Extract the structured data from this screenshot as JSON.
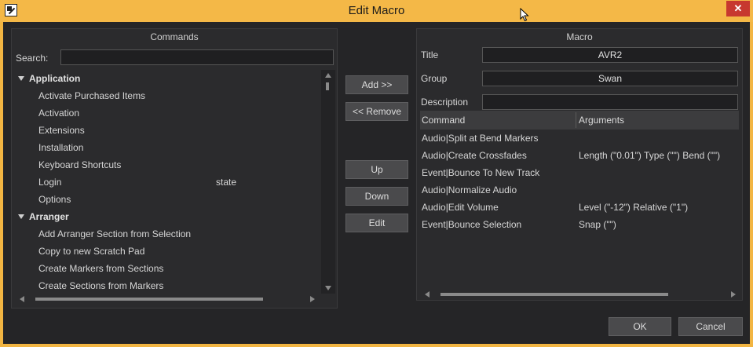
{
  "window": {
    "title": "Edit Macro",
    "close_symbol": "✕"
  },
  "commands": {
    "title": "Commands",
    "search_label": "Search:",
    "search_value": "",
    "tree": [
      {
        "type": "group",
        "label": "Application"
      },
      {
        "type": "item",
        "label": "Activate Purchased Items"
      },
      {
        "type": "item",
        "label": "Activation"
      },
      {
        "type": "item",
        "label": "Extensions"
      },
      {
        "type": "item",
        "label": "Installation"
      },
      {
        "type": "item",
        "label": "Keyboard Shortcuts"
      },
      {
        "type": "item",
        "label": "Login",
        "extra": "state"
      },
      {
        "type": "item",
        "label": "Options"
      },
      {
        "type": "group",
        "label": "Arranger"
      },
      {
        "type": "item",
        "label": "Add Arranger Section from Selection"
      },
      {
        "type": "item",
        "label": "Copy to new Scratch Pad"
      },
      {
        "type": "item",
        "label": "Create Markers from Sections"
      },
      {
        "type": "item",
        "label": "Create Sections from Markers"
      }
    ]
  },
  "buttons": {
    "add": "Add >>",
    "remove": "<< Remove",
    "up": "Up",
    "down": "Down",
    "edit": "Edit",
    "ok": "OK",
    "cancel": "Cancel"
  },
  "macro": {
    "title": "Macro",
    "title_label": "Title",
    "title_value": "AVR2",
    "group_label": "Group",
    "group_value": "Swan",
    "description_label": "Description",
    "description_value": "",
    "columns": [
      "Command",
      "Arguments"
    ],
    "rows": [
      {
        "command": "Audio|Split at Bend Markers",
        "arguments": ""
      },
      {
        "command": "Audio|Create Crossfades",
        "arguments": "Length (\"0.01\") Type (\"\") Bend (\"\")"
      },
      {
        "command": "Event|Bounce To New Track",
        "arguments": ""
      },
      {
        "command": "Audio|Normalize Audio",
        "arguments": ""
      },
      {
        "command": "Audio|Edit Volume",
        "arguments": "Level (\"-12\") Relative (\"1\")"
      },
      {
        "command": "Event|Bounce Selection",
        "arguments": "Snap (\"\")"
      }
    ]
  },
  "colors": {
    "titlebar": "#f4b847",
    "background": "#252527",
    "panel": "#2b2b2d",
    "button": "#4a4a4c",
    "close": "#c7382f"
  }
}
